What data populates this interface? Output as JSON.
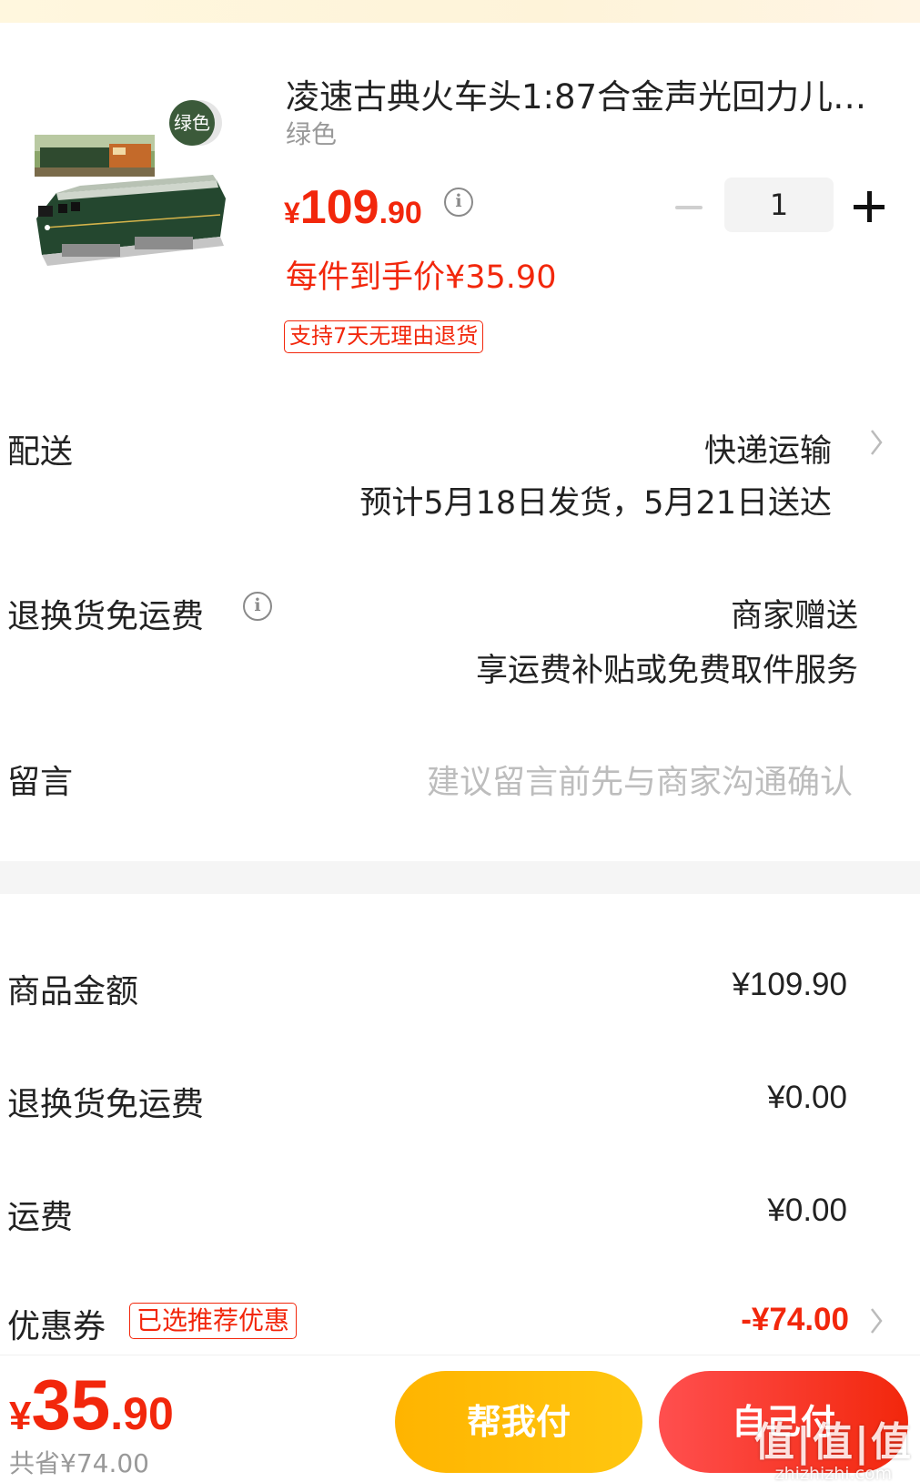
{
  "product": {
    "title": "凌速古典火车头1:87合金声光回力儿…",
    "variant": "绿色",
    "swatch_label": "绿色",
    "price_currency": "¥",
    "price_int": "109",
    "price_dec": ".90",
    "quantity": "1",
    "unit_price": "每件到手价¥35.90",
    "return_tag": "支持7天无理由退货",
    "image_icon": "toy-train-locomotive-image"
  },
  "delivery": {
    "label": "配送",
    "method": "快递运输",
    "estimate": "预计5月18日发货，5月21日送达"
  },
  "return_shipping": {
    "label": "退换货免运费",
    "value": "商家赠送",
    "detail": "享运费补贴或免费取件服务"
  },
  "message": {
    "label": "留言",
    "placeholder": "建议留言前先与商家沟通确认"
  },
  "summary": {
    "goods_label": "商品金额",
    "goods_value": "¥109.90",
    "return_fee_label": "退换货免运费",
    "return_fee_value": "¥0.00",
    "shipping_label": "运费",
    "shipping_value": "¥0.00",
    "coupon_label": "优惠券",
    "coupon_tag": "已选推荐优惠",
    "coupon_value": "-¥74.00"
  },
  "footer": {
    "total_currency": "¥",
    "total_int": "35",
    "total_dec": ".90",
    "saved": "共省¥74.00",
    "help_pay": "帮我付",
    "self_pay": "自己付",
    "watermark_big": "值|值|值",
    "watermark_small": "zhizhizhi.com"
  },
  "colors": {
    "accent_red": "#f2270c",
    "help_pay_yellow": "#ffb400",
    "swatch_green": "#3b5a3a"
  }
}
